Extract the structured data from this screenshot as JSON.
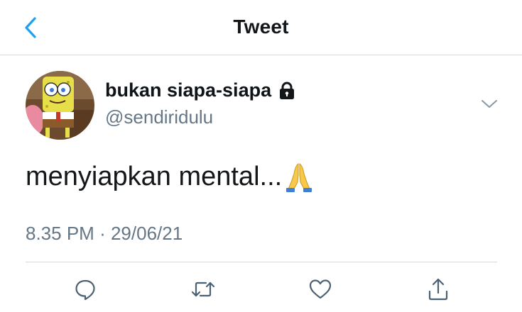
{
  "header": {
    "title": "Tweet",
    "back_icon": "chevron-left-icon",
    "accent": "#1da1f2"
  },
  "tweet": {
    "display_name": "bukan siapa-siapa",
    "username": "@sendiridulu",
    "protected_icon": "lock-icon",
    "text": "menyiapkan mental...",
    "emoji_icon": "folded-hands-icon",
    "time": "8.35 PM",
    "separator": "·",
    "date": "29/06/21"
  },
  "actions": [
    {
      "name": "reply",
      "icon": "speech-bubble-icon"
    },
    {
      "name": "retweet",
      "icon": "retweet-icon"
    },
    {
      "name": "like",
      "icon": "heart-icon"
    },
    {
      "name": "share",
      "icon": "share-icon"
    }
  ],
  "colors": {
    "text": "#14171a",
    "secondary": "#657786",
    "divider": "#d6d9dc",
    "icon": "#4a6174"
  }
}
